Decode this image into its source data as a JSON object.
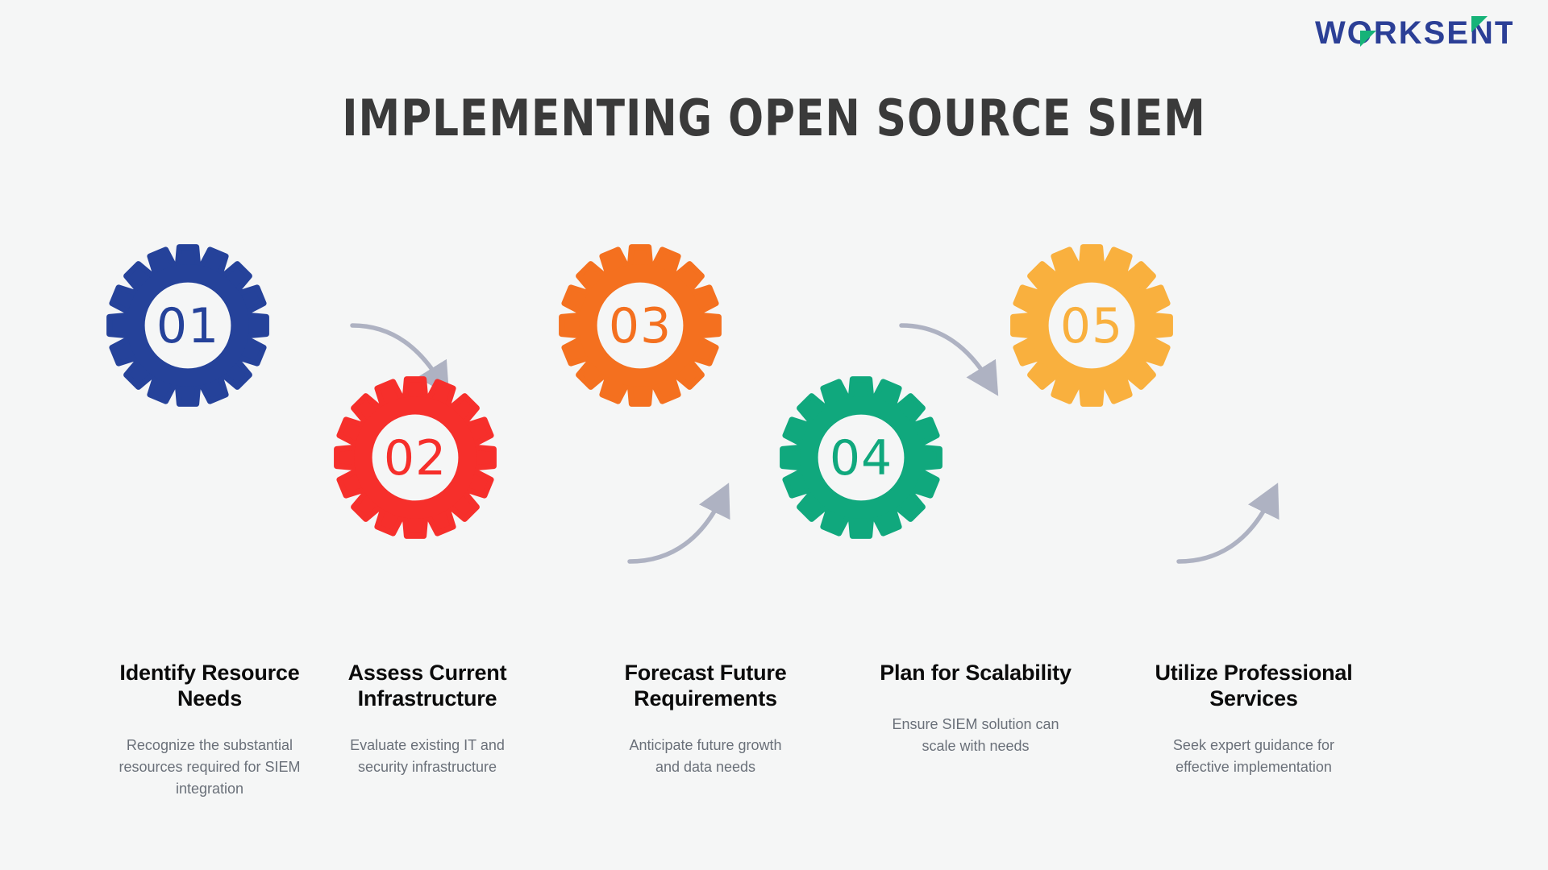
{
  "brand": {
    "logo_text": "WORKSENT",
    "logo_name": "worksent-logo",
    "logo_blue": "#2b3f96",
    "logo_green": "#16b378"
  },
  "header": {
    "title": "IMPLEMENTING OPEN SOURCE SIEM",
    "title_color": "#3a3a3a"
  },
  "canvas": {
    "background": "#f5f6f6",
    "arrow_color": "#aeb2c2"
  },
  "steps": [
    {
      "number": "01",
      "color": "#25429a",
      "heading": "Identify Resource Needs",
      "heading_line1": "Identify Resource",
      "heading_line2": "Needs",
      "description": "Recognize the substantial resources required for SIEM integration",
      "icon": "gear-icon"
    },
    {
      "number": "02",
      "color": "#f62f2b",
      "heading": "Assess Current Infrastructure",
      "heading_line1": "Assess Current",
      "heading_line2": "Infrastructure",
      "description": "Evaluate existing IT and security infrastructure",
      "icon": "gear-icon"
    },
    {
      "number": "03",
      "color": "#f4701f",
      "heading": "Forecast Future Requirements",
      "heading_line1": "Forecast Future",
      "heading_line2": "Requirements",
      "description": "Anticipate future growth and data needs",
      "icon": "gear-icon"
    },
    {
      "number": "04",
      "color": "#10a87d",
      "heading": "Plan for Scalability",
      "heading_line1": "Plan for Scalability",
      "heading_line2": "",
      "description": "Ensure SIEM solution can scale with needs",
      "icon": "gear-icon"
    },
    {
      "number": "05",
      "color": "#f9b03e",
      "heading": "Utilize Professional Services",
      "heading_line1": "Utilize Professional",
      "heading_line2": "Services",
      "description": "Seek expert guidance for effective implementation",
      "icon": "gear-icon"
    }
  ],
  "connectors": [
    {
      "name": "arrow-01-to-02",
      "direction": "down-right"
    },
    {
      "name": "arrow-02-to-03",
      "direction": "up-right"
    },
    {
      "name": "arrow-03-to-04",
      "direction": "down-right"
    },
    {
      "name": "arrow-04-to-05",
      "direction": "up-right"
    }
  ]
}
